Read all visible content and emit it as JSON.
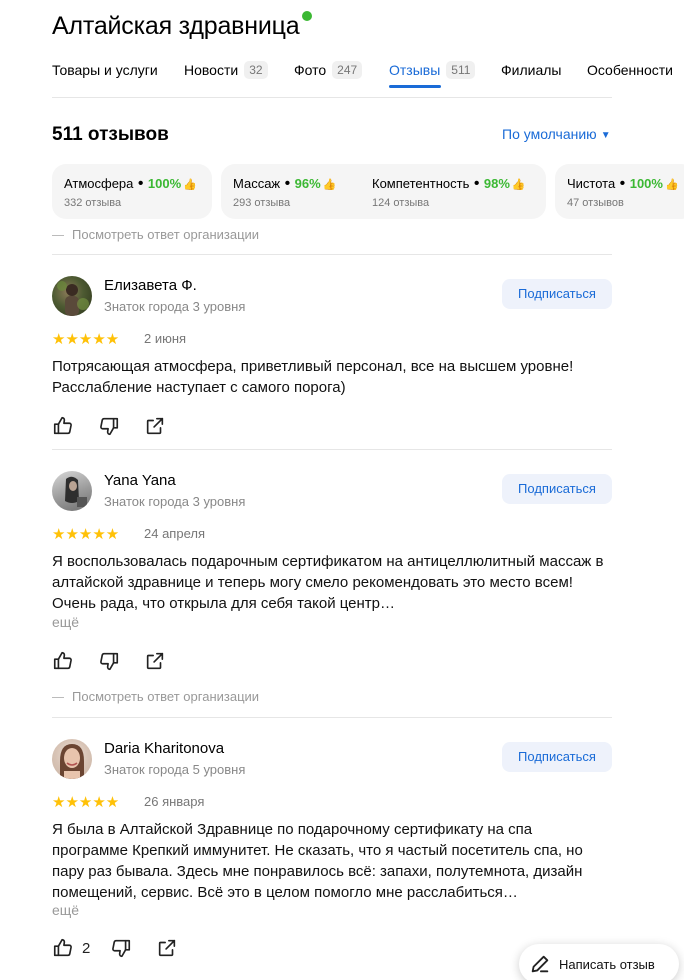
{
  "header": {
    "title": "Алтайская здравница"
  },
  "tabs": [
    {
      "label": "Товары и услуги",
      "count": ""
    },
    {
      "label": "Новости",
      "count": "32"
    },
    {
      "label": "Фото",
      "count": "247"
    },
    {
      "label": "Отзывы",
      "count": "511"
    },
    {
      "label": "Филиалы",
      "count": ""
    },
    {
      "label": "Особенности",
      "count": ""
    }
  ],
  "reviews_header": {
    "count_label": "511 отзывов",
    "sort_label": "По умолчанию"
  },
  "aspects": [
    {
      "name": "Атмосфера",
      "percent": "100%",
      "reviews": "332 отзыва"
    },
    {
      "name": "Массаж",
      "percent": "96%",
      "reviews": "293 отзыва"
    },
    {
      "name": "Компетентность",
      "percent": "98%",
      "reviews": "124 отзыва"
    },
    {
      "name": "Чистота",
      "percent": "100%",
      "reviews": "47 отзывов"
    }
  ],
  "org_reply_label": "Посмотреть ответ организации",
  "subscribe_label": "Подписаться",
  "more_label": "ещё",
  "reviews": [
    {
      "author": "Елизавета Ф.",
      "level": "Знаток города 3 уровня",
      "rating": 5,
      "stars": "★★★★★",
      "date": "2 июня",
      "text": "Потрясающая атмосфера, приветливый персонал, все на высшем уровне! Расслабление наступает с самого порога)",
      "likes": ""
    },
    {
      "author": "Yana Yana",
      "level": "Знаток города 3 уровня",
      "rating": 5,
      "stars": "★★★★★",
      "date": "24 апреля",
      "text": "Я воспользовалась подарочным сертификатом на антицеллюлитный массаж в алтайской здравнице и теперь могу смело рекомендовать это место всем! Очень рада, что открыла для себя такой центр…",
      "likes": ""
    },
    {
      "author": "Daria Kharitonova",
      "level": "Знаток города 5 уровня",
      "rating": 5,
      "stars": "★★★★★",
      "date": "26 января",
      "text": "Я была в Алтайской Здравнице по подарочному сертификату на спа программе Крепкий иммунитет. Не сказать, что я частый посетитель спа, но пару раз бывала. Здесь мне понравилось всё: запахи, полутемнота, дизайн помещений, сервис. Всё это в целом помогло мне расслабиться…",
      "likes": "2"
    }
  ],
  "write_review_label": "Написать отзыв",
  "colors": {
    "accent": "#1a6bd7",
    "positive": "#3bb833",
    "star": "#ffc107"
  },
  "icons": [
    "verified-badge-icon",
    "thumbs-up-icon",
    "thumbs-down-icon",
    "share-icon",
    "pen-icon",
    "chevron-down-icon"
  ]
}
